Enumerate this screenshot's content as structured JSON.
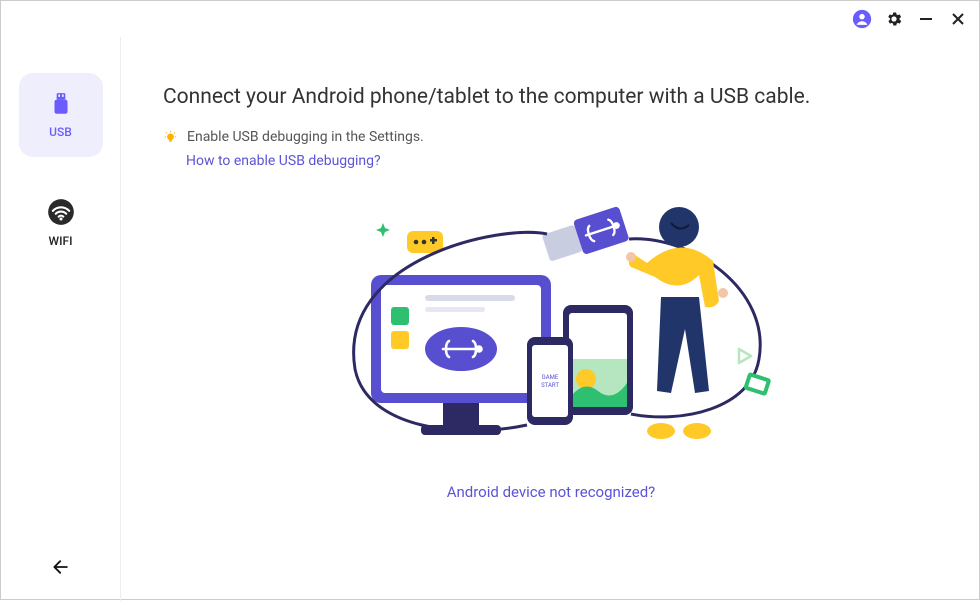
{
  "window": {
    "account_icon": "account-icon",
    "settings_icon": "gear-icon",
    "minimize_icon": "minimize-icon",
    "close_icon": "close-icon"
  },
  "sidebar": {
    "usb": {
      "label": "USB",
      "active": true
    },
    "wifi": {
      "label": "WIFI",
      "active": false
    },
    "back_icon": "back-arrow-icon"
  },
  "main": {
    "headline": "Connect your Android phone/tablet to the computer with a USB cable.",
    "tip": "Enable USB debugging in the Settings.",
    "help_link": "How to enable USB debugging?",
    "not_recognized_link": "Android device not recognized?"
  }
}
